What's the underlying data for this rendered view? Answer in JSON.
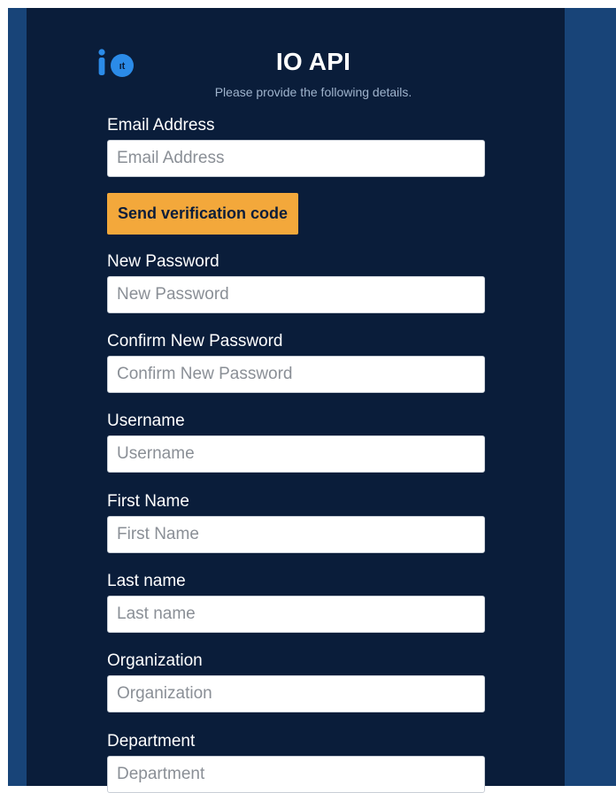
{
  "header": {
    "logo_icon": "io-logo-icon",
    "title": "IO API",
    "subtitle": "Please provide the following details."
  },
  "form": {
    "email": {
      "label": "Email Address",
      "placeholder": "Email Address",
      "value": ""
    },
    "send_code_button": "Send verification code",
    "new_password": {
      "label": "New Password",
      "placeholder": "New Password",
      "value": ""
    },
    "confirm_password": {
      "label": "Confirm New Password",
      "placeholder": "Confirm New Password",
      "value": ""
    },
    "username": {
      "label": "Username",
      "placeholder": "Username",
      "value": ""
    },
    "first_name": {
      "label": "First Name",
      "placeholder": "First Name",
      "value": ""
    },
    "last_name": {
      "label": "Last name",
      "placeholder": "Last name",
      "value": ""
    },
    "organization": {
      "label": "Organization",
      "placeholder": "Organization",
      "value": ""
    },
    "department": {
      "label": "Department",
      "placeholder": "Department",
      "value": ""
    }
  },
  "colors": {
    "page_background": "#184478",
    "panel_background": "#0a1d3a",
    "accent_button": "#f3a83b",
    "logo_blue": "#2b8be8"
  }
}
